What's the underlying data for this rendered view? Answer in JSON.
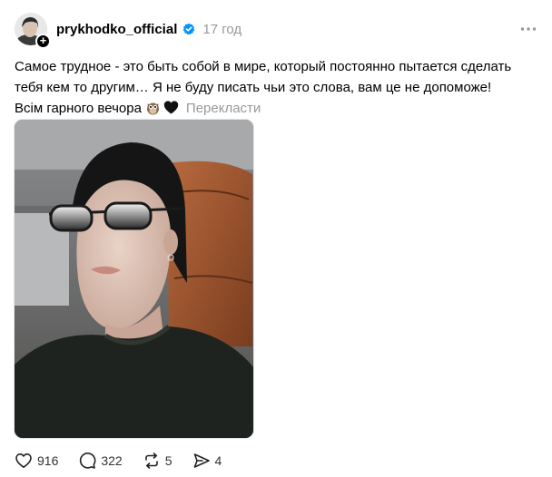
{
  "post": {
    "username": "prykhodko_official",
    "timestamp": "17 год",
    "verified": true,
    "caption_lines": [
      "Самое трудное - это быть собой в мире, который постоянно пытается сделать",
      "тебя кем то другим… Я не буду писать чьи это слова, вам це не допоможе!",
      "Всім гарного вечора"
    ],
    "translate_label": "Перекласти",
    "emojis": [
      "owl-emoji",
      "black-heart-emoji"
    ]
  },
  "actions": {
    "likes": "916",
    "comments": "322",
    "reposts": "5",
    "shares": "4"
  },
  "icons": {
    "like": "heart-icon",
    "comment": "comment-icon",
    "repost": "repost-icon",
    "share": "send-icon",
    "more": "more-icon",
    "verified": "verified-icon",
    "follow": "plus-icon"
  },
  "colors": {
    "verified": "#0095f6",
    "muted_text": "#999999",
    "text": "#000000"
  }
}
